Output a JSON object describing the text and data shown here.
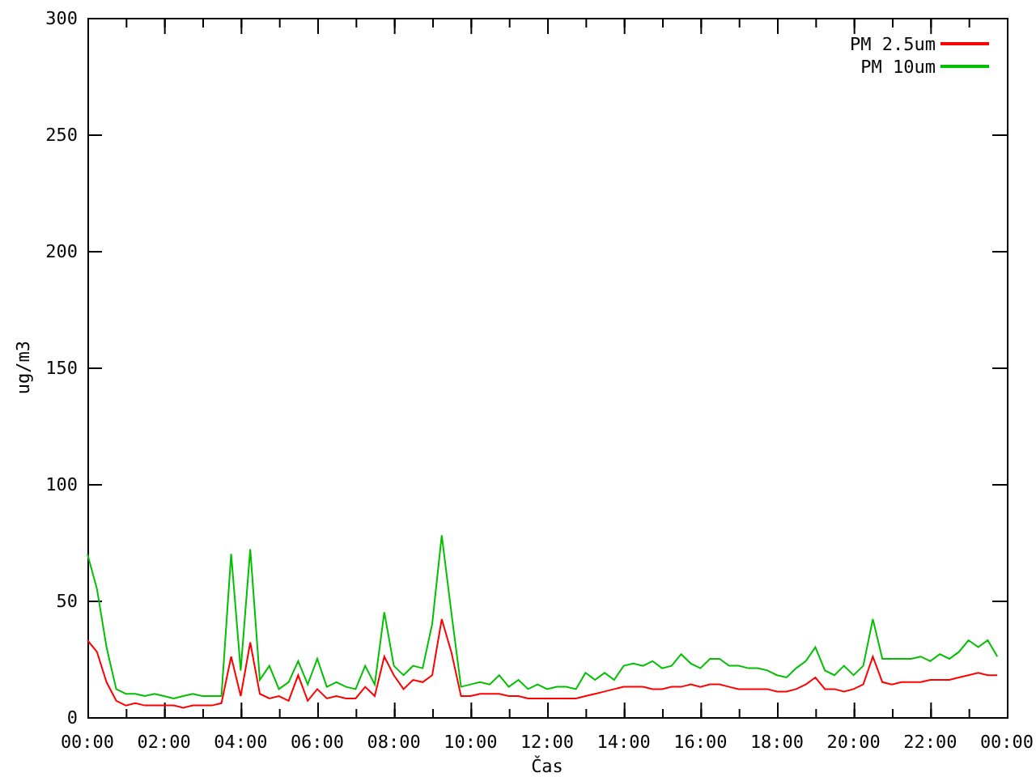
{
  "chart": {
    "chart_data": {
      "type": "line",
      "xlabel": "Čas",
      "ylabel": "ug/m3",
      "x": [
        0,
        0.25,
        0.5,
        0.75,
        1,
        1.25,
        1.5,
        1.75,
        2,
        2.25,
        2.5,
        2.75,
        3,
        3.25,
        3.5,
        3.75,
        4,
        4.25,
        4.5,
        4.75,
        5,
        5.25,
        5.5,
        5.75,
        6,
        6.25,
        6.5,
        6.75,
        7,
        7.25,
        7.5,
        7.75,
        8,
        8.25,
        8.5,
        8.75,
        9,
        9.25,
        9.5,
        9.75,
        10,
        10.25,
        10.5,
        10.75,
        11,
        11.25,
        11.5,
        11.75,
        12,
        12.25,
        12.5,
        12.75,
        13,
        13.25,
        13.5,
        13.75,
        14,
        14.25,
        14.5,
        14.75,
        15,
        15.25,
        15.5,
        15.75,
        16,
        16.25,
        16.5,
        16.75,
        17,
        17.25,
        17.5,
        17.75,
        18,
        18.25,
        18.5,
        18.75,
        19,
        19.25,
        19.5,
        19.75,
        20,
        20.25,
        20.5,
        20.75,
        21,
        21.25,
        21.5,
        21.75,
        22,
        22.25,
        22.5,
        22.75,
        23,
        23.25,
        23.5,
        23.75
      ],
      "series": [
        {
          "name": "PM 2.5um",
          "color": "#ff0000",
          "values": [
            33,
            28,
            15,
            7,
            5,
            6,
            5,
            5,
            5,
            5,
            4,
            5,
            5,
            5,
            6,
            26,
            9,
            32,
            10,
            8,
            9,
            7,
            18,
            7,
            12,
            8,
            9,
            8,
            8,
            13,
            9,
            26,
            18,
            12,
            16,
            15,
            18,
            42,
            28,
            9,
            9,
            10,
            10,
            10,
            9,
            9,
            8,
            8,
            8,
            8,
            8,
            8,
            9,
            10,
            11,
            12,
            13,
            13,
            13,
            12,
            12,
            13,
            13,
            14,
            13,
            14,
            14,
            13,
            12,
            12,
            12,
            12,
            11,
            11,
            12,
            14,
            17,
            12,
            12,
            11,
            12,
            14,
            26,
            15,
            14,
            15,
            15,
            15,
            16,
            16,
            16,
            17,
            18,
            19,
            18,
            18
          ]
        },
        {
          "name": "PM 10um",
          "color": "#00c000",
          "values": [
            70,
            55,
            30,
            12,
            10,
            10,
            9,
            10,
            9,
            8,
            9,
            10,
            9,
            9,
            9,
            70,
            20,
            72,
            16,
            22,
            12,
            15,
            24,
            14,
            25,
            13,
            15,
            13,
            12,
            22,
            14,
            45,
            22,
            18,
            22,
            21,
            40,
            78,
            45,
            13,
            14,
            15,
            14,
            18,
            13,
            16,
            12,
            14,
            12,
            13,
            13,
            12,
            19,
            16,
            19,
            16,
            22,
            23,
            22,
            24,
            21,
            22,
            27,
            23,
            21,
            25,
            25,
            22,
            22,
            21,
            21,
            20,
            18,
            17,
            21,
            24,
            30,
            20,
            18,
            22,
            18,
            22,
            42,
            25,
            25,
            25,
            25,
            26,
            24,
            27,
            25,
            28,
            33,
            30,
            33,
            26
          ]
        }
      ],
      "legend": "upper right",
      "xlim": [
        0,
        24
      ],
      "ylim": [
        0,
        300
      ],
      "xticks": [
        {
          "value": 0,
          "label": "00:00"
        },
        {
          "value": 2,
          "label": "02:00"
        },
        {
          "value": 4,
          "label": "04:00"
        },
        {
          "value": 6,
          "label": "06:00"
        },
        {
          "value": 8,
          "label": "08:00"
        },
        {
          "value": 10,
          "label": "10:00"
        },
        {
          "value": 12,
          "label": "12:00"
        },
        {
          "value": 14,
          "label": "14:00"
        },
        {
          "value": 16,
          "label": "16:00"
        },
        {
          "value": 18,
          "label": "18:00"
        },
        {
          "value": 20,
          "label": "20:00"
        },
        {
          "value": 22,
          "label": "22:00"
        },
        {
          "value": 24,
          "label": "00:00"
        }
      ],
      "yticks": [
        0,
        50,
        100,
        150,
        200,
        250,
        300
      ]
    }
  }
}
